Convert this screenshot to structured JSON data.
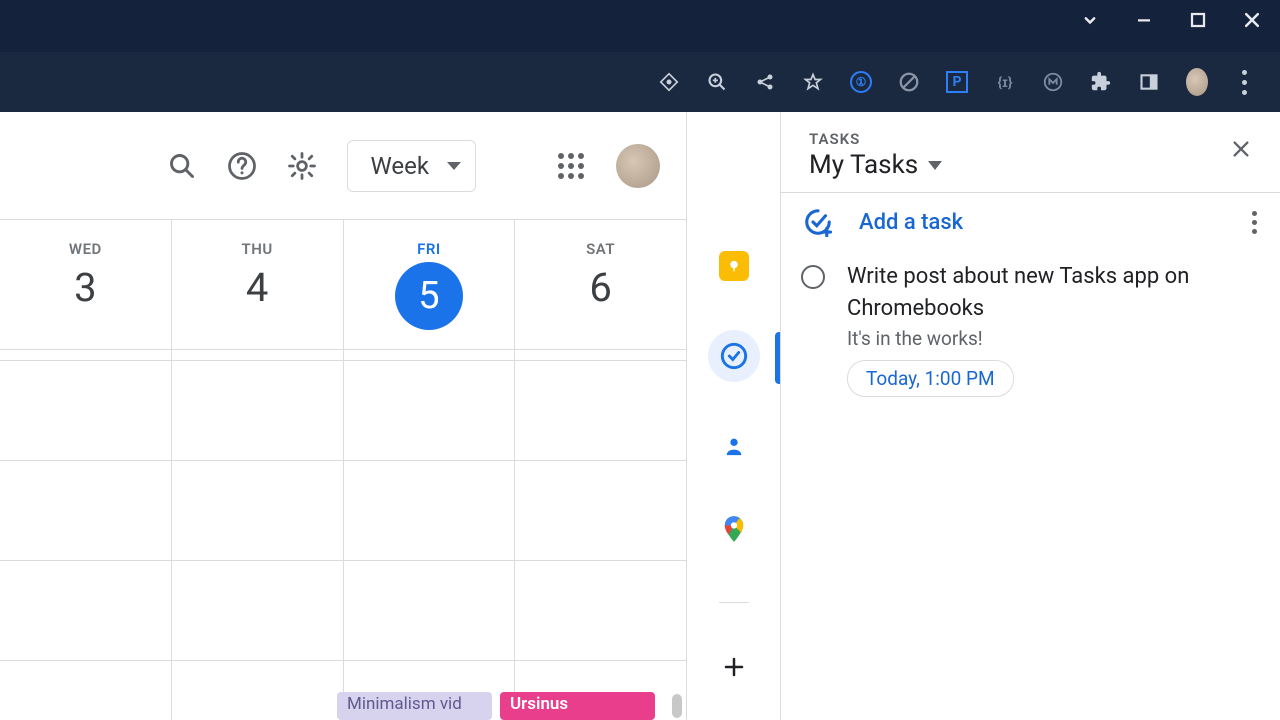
{
  "calendar": {
    "view_label": "Week",
    "days": [
      {
        "label": "WED",
        "num": "3",
        "today": false
      },
      {
        "label": "THU",
        "num": "4",
        "today": false
      },
      {
        "label": "FRI",
        "num": "5",
        "today": true
      },
      {
        "label": "SAT",
        "num": "6",
        "today": false
      }
    ],
    "events": [
      {
        "title": "Minimalism vid",
        "color": "purple",
        "col": 2
      },
      {
        "title": "Ursinus",
        "color": "pink",
        "col": 3
      }
    ]
  },
  "tasks": {
    "panel_title": "TASKS",
    "list_name": "My Tasks",
    "add_label": "Add a task",
    "items": [
      {
        "title": "Write post about new Tasks app on Chromebooks",
        "note": "It's in the works!",
        "due": "Today, 1:00 PM"
      }
    ]
  }
}
